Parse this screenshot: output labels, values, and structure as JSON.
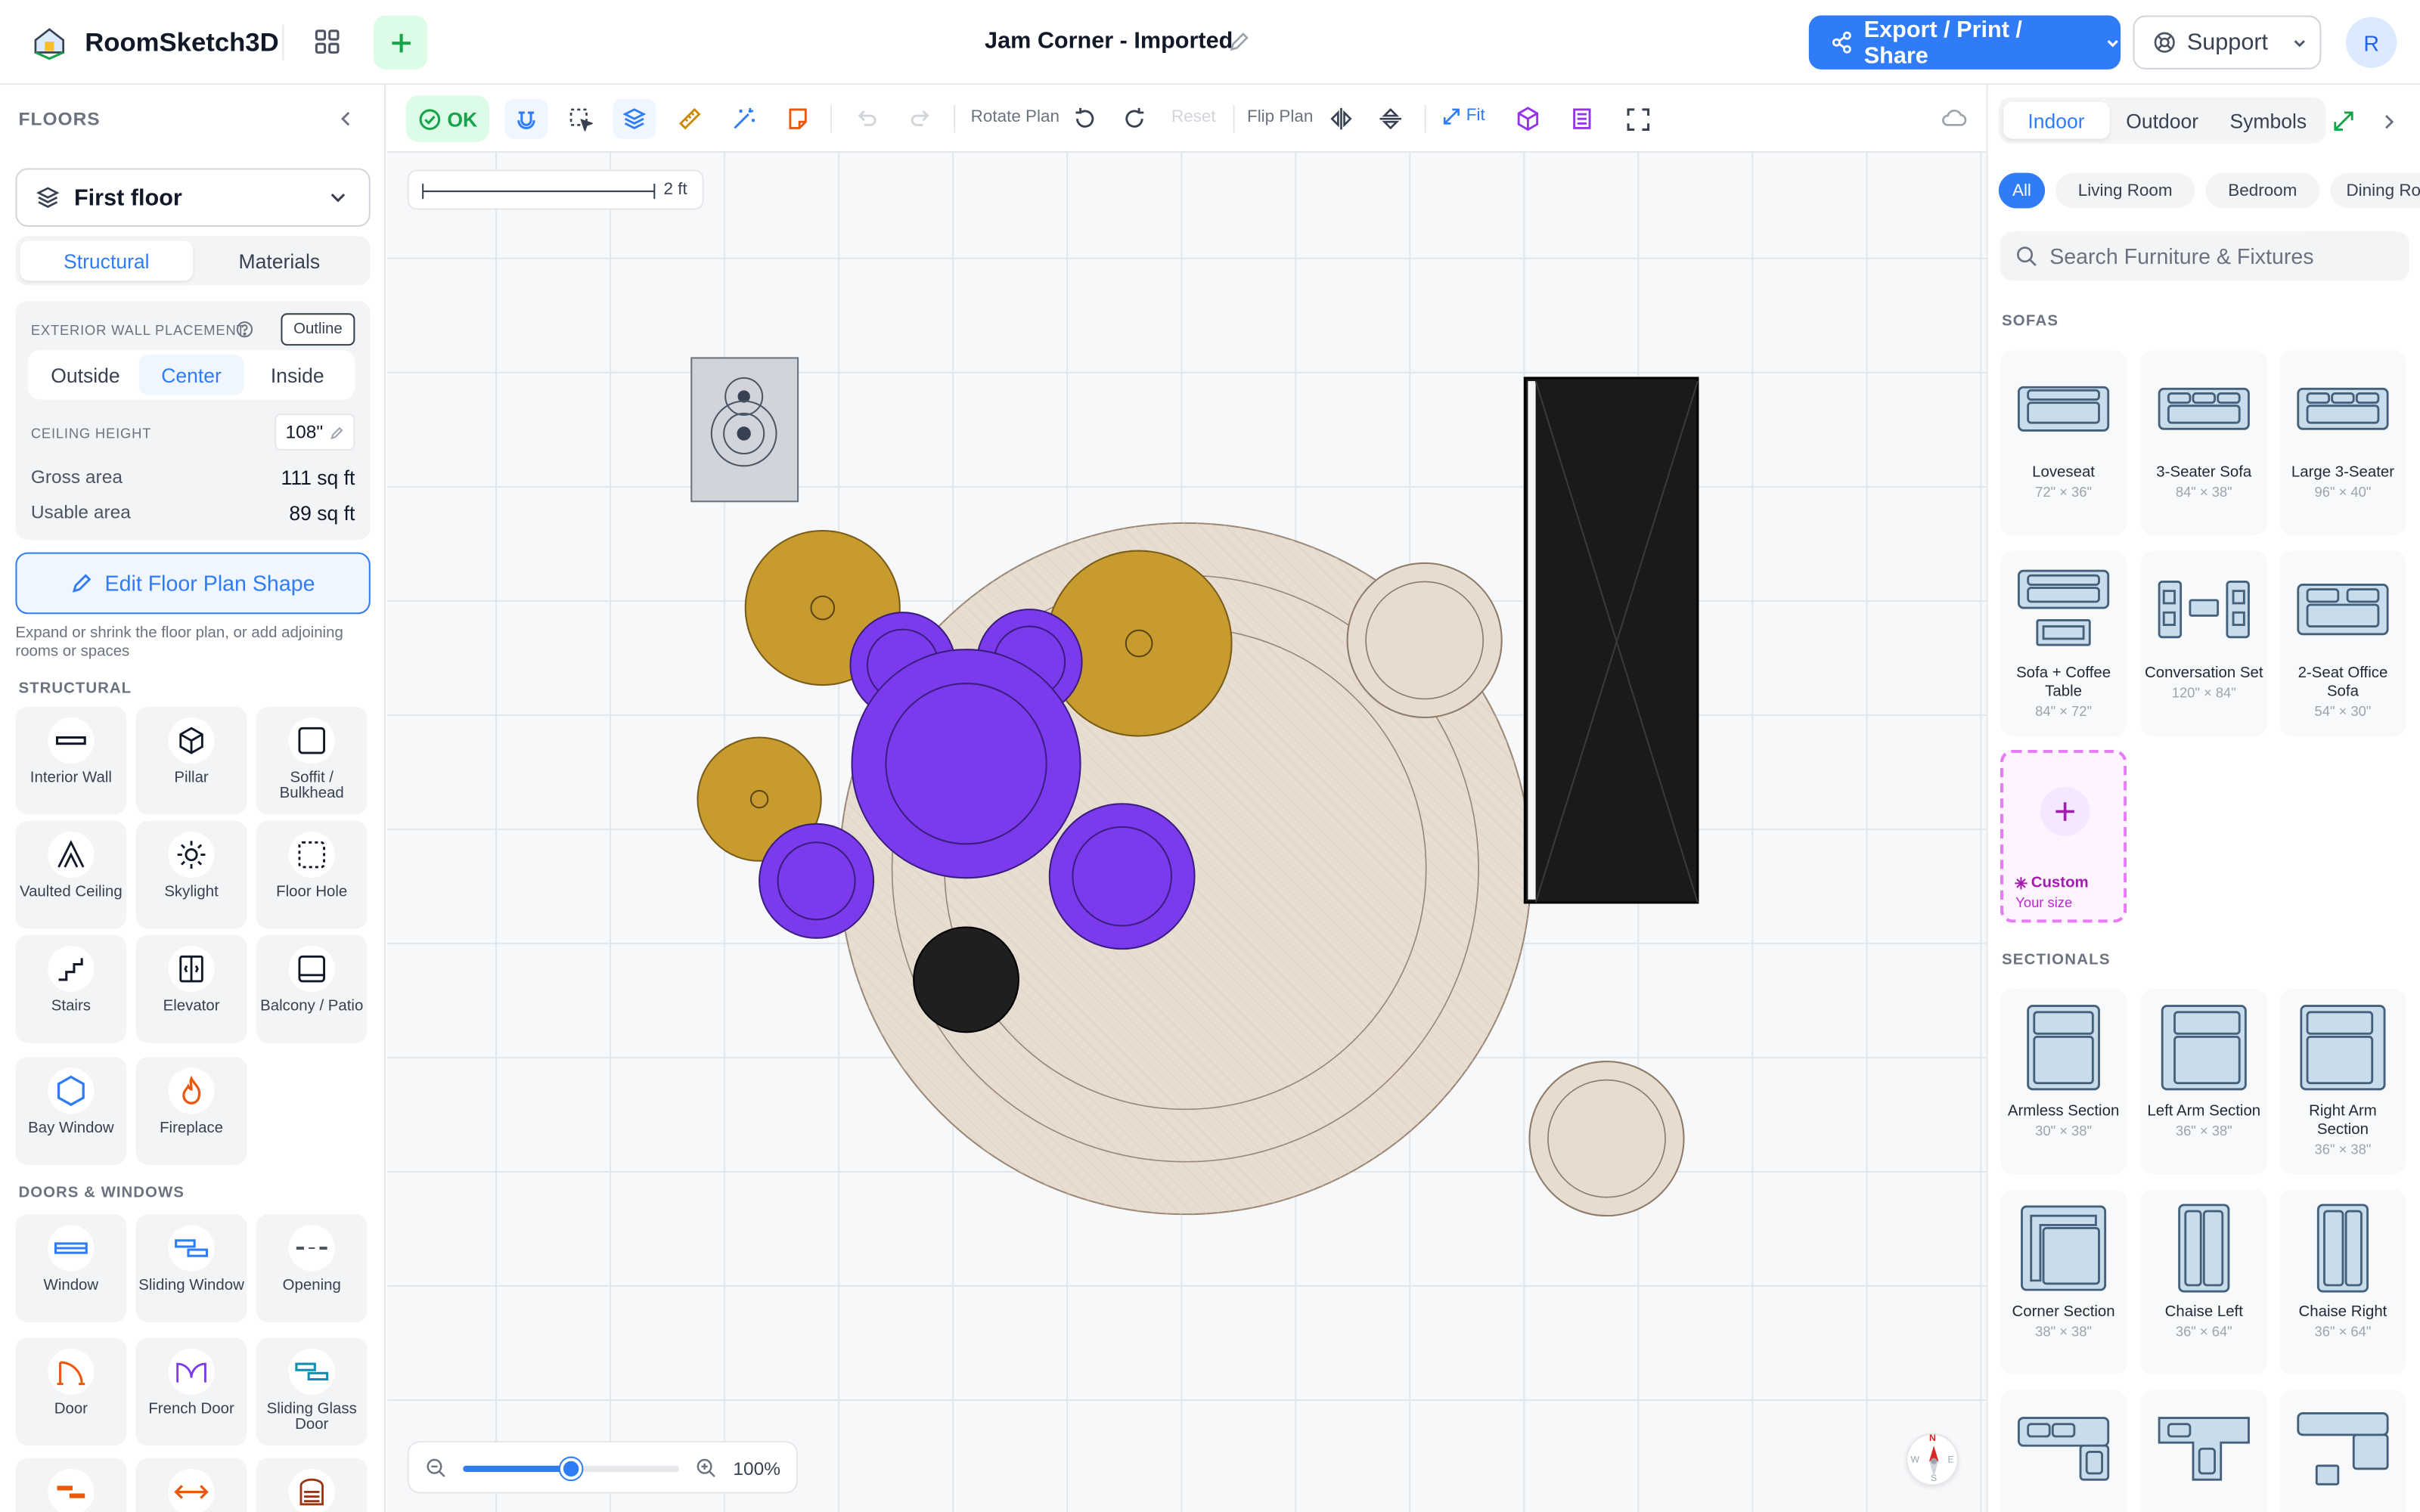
{
  "app": {
    "name": "RoomSketch3D",
    "document_title": "Jam Corner - Imported"
  },
  "header": {
    "export_label": "Export / Print / Share",
    "support_label": "Support",
    "avatar_initial": "R"
  },
  "left": {
    "floors_heading": "FLOORS",
    "floor_selected": "First floor",
    "tabs": [
      "Structural",
      "Materials"
    ],
    "wall_placement_label": "EXTERIOR WALL PLACEMENT",
    "outline_label": "Outline",
    "wall_options": [
      "Outside",
      "Center",
      "Inside"
    ],
    "ceiling_label": "CEILING HEIGHT",
    "ceiling_value": "108\"",
    "gross_label": "Gross area",
    "gross_value": "111 sq ft",
    "usable_label": "Usable area",
    "usable_value": "89 sq ft",
    "edit_button": "Edit Floor Plan Shape",
    "edit_hint": "Expand or shrink the floor plan, or add adjoining rooms or spaces",
    "structural_heading": "STRUCTURAL",
    "structural_items": [
      "Interior Wall",
      "Pillar",
      "Soffit / Bulkhead",
      "Vaulted Ceiling",
      "Skylight",
      "Floor Hole",
      "Stairs",
      "Elevator",
      "Balcony / Patio",
      "Bay Window",
      "Fireplace"
    ],
    "doors_heading": "DOORS & WINDOWS",
    "door_items": [
      "Window",
      "Sliding Window",
      "Opening",
      "Door",
      "French Door",
      "Sliding Glass Door"
    ]
  },
  "toolbar": {
    "ok_label": "OK",
    "rotate_label": "Rotate Plan",
    "reset_label": "Reset",
    "flip_label": "Flip Plan",
    "fit_label": "Fit"
  },
  "canvas": {
    "scale_label": "2 ft",
    "zoom_label": "100%",
    "zoom_level": 0.5
  },
  "compass": {
    "n": "N",
    "w": "W",
    "e": "E",
    "s": "S"
  },
  "right": {
    "tabs": [
      "Indoor",
      "Outdoor",
      "Symbols"
    ],
    "chips": [
      "All",
      "Living Room",
      "Bedroom",
      "Dining Room"
    ],
    "search_placeholder": "Search Furniture & Fixtures",
    "sofas_heading": "SOFAS",
    "sofas": [
      {
        "name": "Loveseat",
        "dims": "72\" × 36\""
      },
      {
        "name": "3-Seater Sofa",
        "dims": "84\" × 38\""
      },
      {
        "name": "Large 3-Seater",
        "dims": "96\" × 40\""
      },
      {
        "name": "Sofa + Coffee Table",
        "dims": "84\" × 72\""
      },
      {
        "name": "Conversation Set",
        "dims": "120\" × 84\""
      },
      {
        "name": "2-Seat Office Sofa",
        "dims": "54\" × 30\""
      }
    ],
    "custom_label": "Custom",
    "custom_sub": "Your size",
    "sectionals_heading": "SECTIONALS",
    "sectionals": [
      {
        "name": "Armless Section",
        "dims": "30\" × 38\""
      },
      {
        "name": "Left Arm Section",
        "dims": "36\" × 38\""
      },
      {
        "name": "Right Arm Section",
        "dims": "36\" × 38\""
      },
      {
        "name": "Corner Section",
        "dims": "38\" × 38\""
      },
      {
        "name": "Chaise Left",
        "dims": "36\" × 64\""
      },
      {
        "name": "Chaise Right",
        "dims": "36\" × 64\""
      }
    ]
  },
  "colors": {
    "accent": "#2f7cf6",
    "purple": "#7c3aed",
    "gold": "#c99a2e",
    "rug": "#e6dcd0",
    "dark": "#1a1a1a"
  }
}
